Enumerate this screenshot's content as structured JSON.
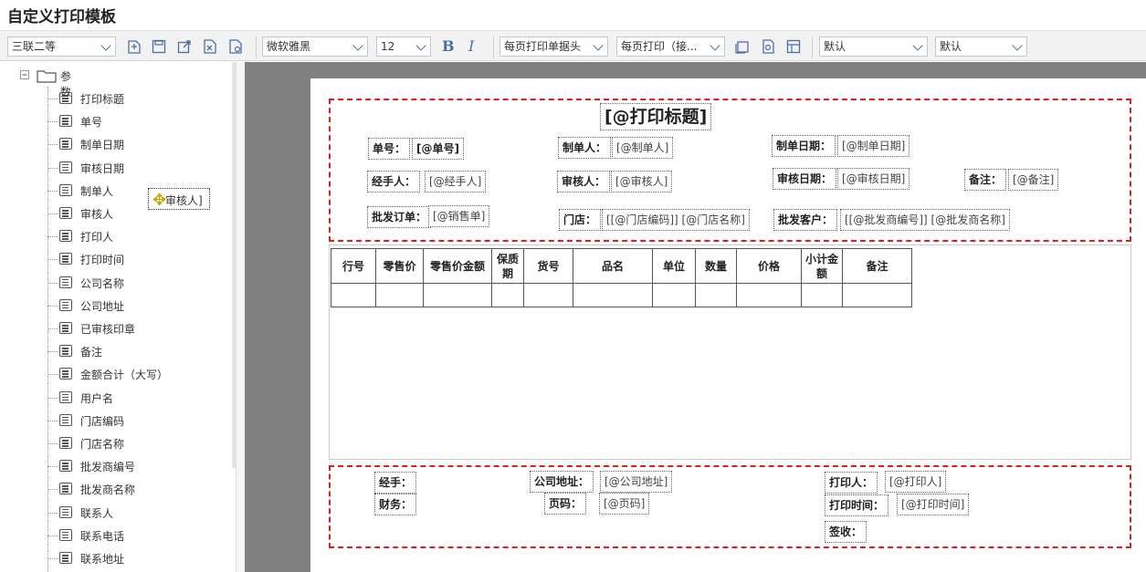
{
  "window": {
    "title": "自定义打印模板"
  },
  "toolbar": {
    "paper_select": "三联二等",
    "font_select": "微软雅黑",
    "size_select": "12",
    "bold_label": "B",
    "italic_label": "I",
    "header_select": "每页打印单据头",
    "page_select": "每页打印（接...",
    "default_select_1": "默认",
    "default_select_2": "默认"
  },
  "tree": {
    "root_label": "参数",
    "items": [
      "打印标题",
      "单号",
      "制单日期",
      "审核日期",
      "制单人",
      "审核人",
      "打印人",
      "打印时间",
      "公司名称",
      "公司地址",
      "已审核印章",
      "备注",
      "金额合计（大写）",
      "用户名",
      "门店编码",
      "门店名称",
      "批发商编号",
      "批发商名称",
      "联系人",
      "联系电话",
      "联系地址"
    ],
    "drag_label": "审核人]"
  },
  "header": {
    "title": "[@打印标题]",
    "fields": {
      "order_no_label": "单号：",
      "order_no_value": "[@单号]",
      "maker_label": "制单人：",
      "maker_value": "[@制单人]",
      "make_date_label": "制单日期：",
      "make_date_value": "[@制单日期]",
      "handler_label": "经手人：",
      "handler_value": "[@经手人]",
      "auditor_label": "审核人：",
      "auditor_value": "[@审核人]",
      "audit_date_label": "审核日期：",
      "audit_date_value": "[@审核日期]",
      "remark_label": "备注：",
      "remark_value": "[@备注]",
      "wholesale_order_label": "批发订单：",
      "wholesale_order_value": "[@销售单]",
      "store_label": "门店：",
      "store_value": "[[@门店编码]] [@门店名称]",
      "customer_label": "批发客户：",
      "customer_value": "[[@批发商编号]] [@批发商名称]"
    }
  },
  "table": {
    "columns": [
      "行号",
      "零售价",
      "零售价金额",
      "保质期",
      "货号",
      "品名",
      "单位",
      "数量",
      "价格",
      "小计金额",
      "备注"
    ]
  },
  "footer": {
    "handler_label": "经手：",
    "finance_label": "财务：",
    "address_label": "公司地址：",
    "address_value": "[@公司地址]",
    "page_label": "页码：",
    "page_value": "[@页码]",
    "printer_label": "打印人：",
    "printer_value": "[@打印人]",
    "print_time_label": "打印时间：",
    "print_time_value": "[@打印时间]",
    "sign_label": "签收："
  }
}
